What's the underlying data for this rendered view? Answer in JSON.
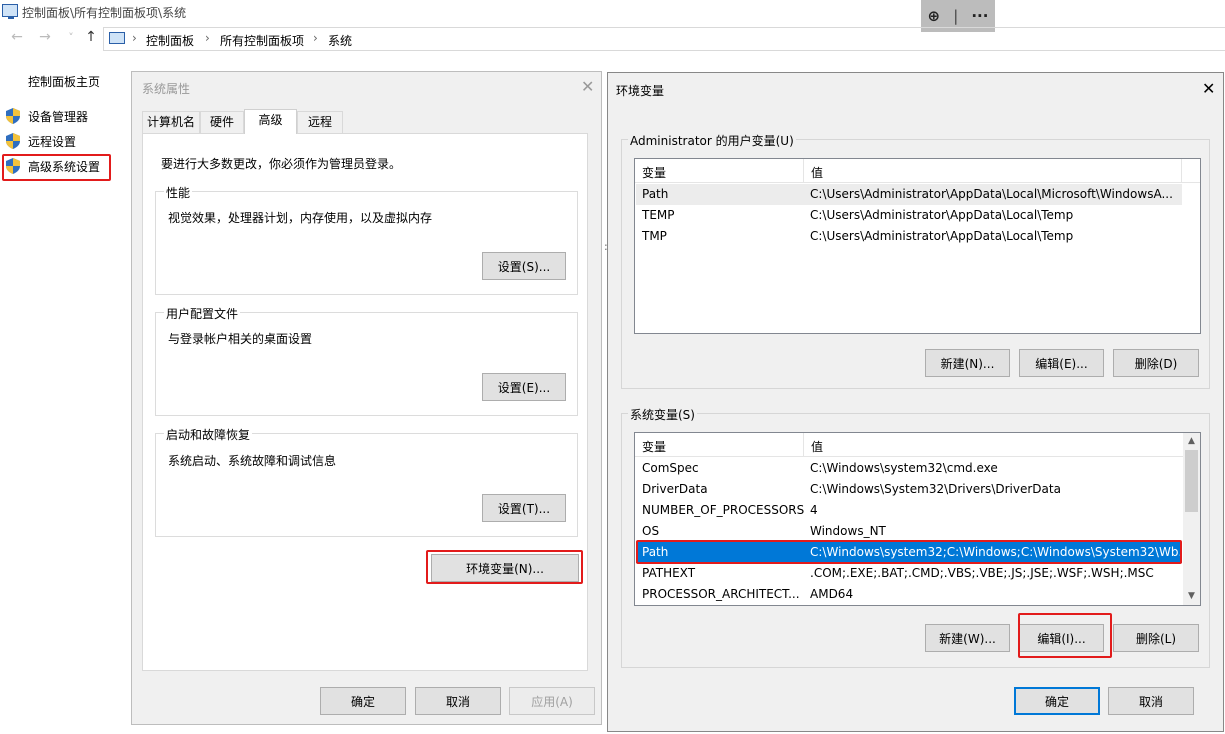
{
  "explorer": {
    "title": "控制面板\\所有控制面板项\\系统",
    "breadcrumb": [
      "控制面板",
      "所有控制面板项",
      "系统"
    ],
    "breadcrumb_sep": "›",
    "nav_back": "←",
    "nav_forward": "→",
    "nav_dropdown": "˅",
    "nav_up": "↑"
  },
  "zoom_toolbar": {
    "zoom": "⊕",
    "sep": "|",
    "more": "···"
  },
  "left_nav": {
    "title": "控制面板主页",
    "items": [
      {
        "label": "设备管理器"
      },
      {
        "label": "远程设置"
      },
      {
        "label": "高级系统设置"
      }
    ]
  },
  "sys_props": {
    "title": "系统属性",
    "close": "✕",
    "tabs": [
      "计算机名",
      "硬件",
      "高级",
      "远程"
    ],
    "active_tab": "高级",
    "admin_note": "要进行大多数更改，你必须作为管理员登录。",
    "performance": {
      "legend": "性能",
      "desc": "视觉效果，处理器计划，内存使用，以及虚拟内存",
      "button": "设置(S)..."
    },
    "profiles": {
      "legend": "用户配置文件",
      "desc": "与登录帐户相关的桌面设置",
      "button": "设置(E)..."
    },
    "startup": {
      "legend": "启动和故障恢复",
      "desc": "系统启动、系统故障和调试信息",
      "button": "设置(T)..."
    },
    "env_button": "环境变量(N)...",
    "ok": "确定",
    "cancel": "取消",
    "apply": "应用(A)"
  },
  "env_vars": {
    "title": "环境变量",
    "close": "✕",
    "user_title": "Administrator 的用户变量(U)",
    "col_var": "变量",
    "col_val": "值",
    "user_rows": [
      {
        "name": "Path",
        "value": "C:\\Users\\Administrator\\AppData\\Local\\Microsoft\\WindowsA..."
      },
      {
        "name": "TEMP",
        "value": "C:\\Users\\Administrator\\AppData\\Local\\Temp"
      },
      {
        "name": "TMP",
        "value": "C:\\Users\\Administrator\\AppData\\Local\\Temp"
      }
    ],
    "user_buttons": {
      "new": "新建(N)...",
      "edit": "编辑(E)...",
      "delete": "删除(D)"
    },
    "sys_title": "系统变量(S)",
    "sys_rows": [
      {
        "name": "ComSpec",
        "value": "C:\\Windows\\system32\\cmd.exe"
      },
      {
        "name": "DriverData",
        "value": "C:\\Windows\\System32\\Drivers\\DriverData"
      },
      {
        "name": "NUMBER_OF_PROCESSORS",
        "value": "4"
      },
      {
        "name": "OS",
        "value": "Windows_NT"
      },
      {
        "name": "Path",
        "value": "C:\\Windows\\system32;C:\\Windows;C:\\Windows\\System32\\Wb..."
      },
      {
        "name": "PATHEXT",
        "value": ".COM;.EXE;.BAT;.CMD;.VBS;.VBE;.JS;.JSE;.WSF;.WSH;.MSC"
      },
      {
        "name": "PROCESSOR_ARCHITECT...",
        "value": "AMD64"
      }
    ],
    "sys_buttons": {
      "new": "新建(W)...",
      "edit": "编辑(I)...",
      "delete": "删除(L)"
    },
    "scroll_up": "▲",
    "scroll_down": "▼",
    "ok": "确定",
    "cancel": "取消"
  },
  "colors": {
    "highlight": "#e21b1b",
    "selection": "#0078d7"
  }
}
